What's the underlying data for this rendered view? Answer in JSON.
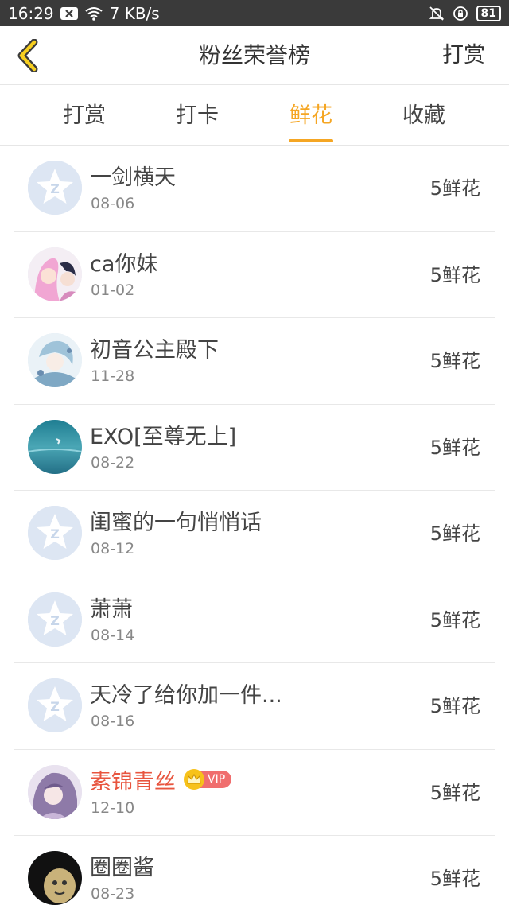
{
  "status_bar": {
    "time": "16:29",
    "speed": "7 KB/s",
    "battery": "81"
  },
  "header": {
    "title": "粉丝荣誉榜",
    "action": "打赏"
  },
  "tabs": [
    {
      "label": "打赏",
      "active": false
    },
    {
      "label": "打卡",
      "active": false
    },
    {
      "label": "鲜花",
      "active": true
    },
    {
      "label": "收藏",
      "active": false
    }
  ],
  "colors": {
    "accent": "#f5a623",
    "vip_name": "#e8553f"
  },
  "fans": [
    {
      "name": "一剑横天",
      "date": "08-06",
      "amount": "5鲜花",
      "avatar": "default-star-avatar",
      "vip": false
    },
    {
      "name": "ca你妹",
      "date": "01-02",
      "amount": "5鲜花",
      "avatar": "anime-pink-hair-avatar",
      "vip": false
    },
    {
      "name": "初音公主殿下",
      "date": "11-28",
      "amount": "5鲜花",
      "avatar": "anime-blue-hair-avatar",
      "vip": false
    },
    {
      "name": "EXO[至尊无上]",
      "date": "08-22",
      "amount": "5鲜花",
      "avatar": "ocean-scene-avatar",
      "vip": false
    },
    {
      "name": "闺蜜的一句悄悄话",
      "date": "08-12",
      "amount": "5鲜花",
      "avatar": "default-star-avatar",
      "vip": false
    },
    {
      "name": "萧萧",
      "date": "08-14",
      "amount": "5鲜花",
      "avatar": "default-star-avatar",
      "vip": false
    },
    {
      "name": "天冷了给你加一件...",
      "date": "08-16",
      "amount": "5鲜花",
      "avatar": "default-star-avatar",
      "vip": false
    },
    {
      "name": "素锦青丝",
      "date": "12-10",
      "amount": "5鲜花",
      "avatar": "anime-purple-hair-avatar",
      "vip": true,
      "vip_label": "VIP"
    },
    {
      "name": "圈圈酱",
      "date": "08-23",
      "amount": "5鲜花",
      "avatar": "meme-face-avatar",
      "vip": false
    }
  ]
}
